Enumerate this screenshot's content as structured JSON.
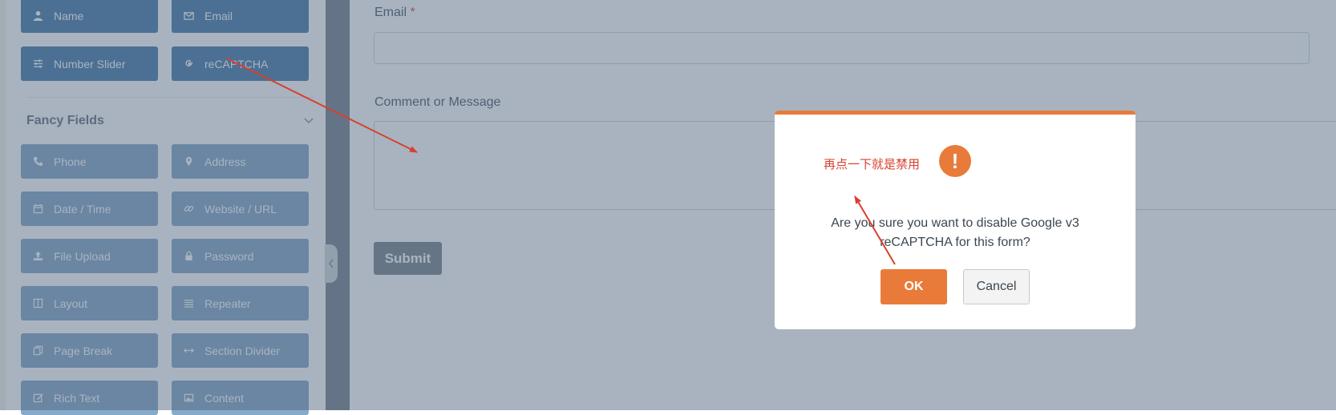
{
  "sidebar": {
    "standard_fields": [
      {
        "label": "Name",
        "icon": "user-icon"
      },
      {
        "label": "Email",
        "icon": "envelope-icon"
      },
      {
        "label": "Number Slider",
        "icon": "sliders-icon"
      },
      {
        "label": "reCAPTCHA",
        "icon": "google-icon"
      }
    ],
    "fancy_section_title": "Fancy Fields",
    "fancy_fields": [
      {
        "label": "Phone",
        "icon": "phone-icon"
      },
      {
        "label": "Address",
        "icon": "map-marker-icon"
      },
      {
        "label": "Date / Time",
        "icon": "calendar-icon"
      },
      {
        "label": "Website / URL",
        "icon": "link-icon"
      },
      {
        "label": "File Upload",
        "icon": "upload-icon"
      },
      {
        "label": "Password",
        "icon": "lock-icon"
      },
      {
        "label": "Layout",
        "icon": "columns-icon"
      },
      {
        "label": "Repeater",
        "icon": "list-icon"
      },
      {
        "label": "Page Break",
        "icon": "copy-icon"
      },
      {
        "label": "Section Divider",
        "icon": "arrows-h-icon"
      },
      {
        "label": "Rich Text",
        "icon": "edit-icon"
      },
      {
        "label": "Content",
        "icon": "image-icon"
      }
    ]
  },
  "form": {
    "email_label": "Email",
    "required_mark": "*",
    "comment_label": "Comment or Message",
    "submit_label": "Submit"
  },
  "dialog": {
    "annotation": "再点一下就是禁用",
    "warning_symbol": "!",
    "message": "Are you sure you want to disable Google v3 reCAPTCHA for this form?",
    "ok_label": "OK",
    "cancel_label": "Cancel"
  },
  "colors": {
    "standard_button": "#4b7fad",
    "fancy_button": "#86aaca",
    "accent": "#e97b3a",
    "annotation": "#d8402e"
  }
}
